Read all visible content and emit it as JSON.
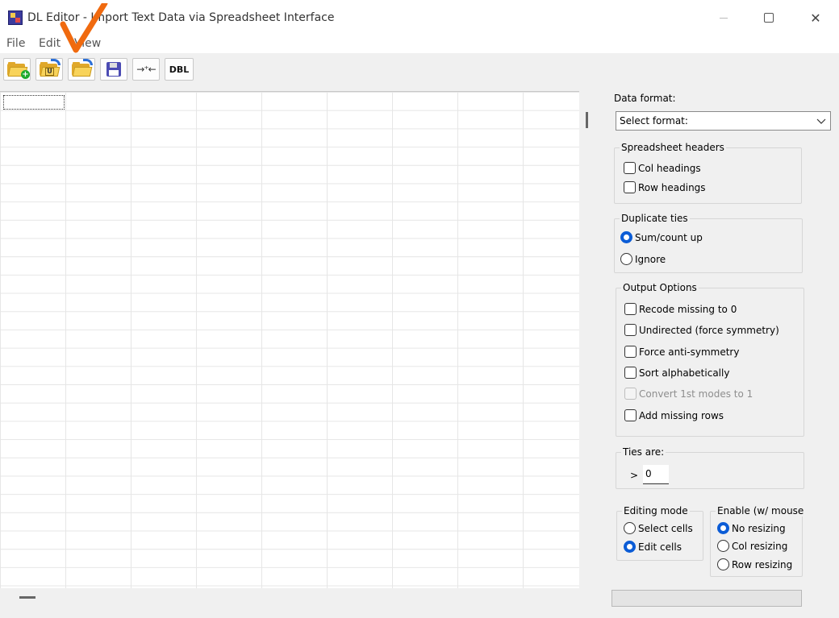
{
  "window": {
    "title": "DL Editor - Import Text Data via Spreadsheet Interface"
  },
  "menu": {
    "items": [
      "File",
      "Edit",
      "View"
    ]
  },
  "toolbar": {
    "buttons": [
      {
        "icon": "open-folder-add-icon"
      },
      {
        "icon": "open-ucinet-folder-icon",
        "badge": "U"
      },
      {
        "icon": "reload-folder-icon"
      },
      {
        "icon": "save-floppy-icon"
      },
      {
        "icon": "collapse-arrows-icon",
        "glyph": "→⁺←"
      },
      {
        "icon": "dbl-icon",
        "label": "DBL"
      }
    ]
  },
  "panel": {
    "data_format_label": "Data format:",
    "data_format_value": "Select format:",
    "headers": {
      "title": "Spreadsheet headers",
      "col": "Col headings",
      "row": "Row headings"
    },
    "duplicate": {
      "title": "Duplicate ties",
      "sum": "Sum/count up",
      "ignore": "Ignore",
      "selected": "Sum/count up"
    },
    "output": {
      "title": "Output Options",
      "recode": "Recode missing to 0",
      "undirected": "Undirected (force symmetry)",
      "antisym": "Force anti-symmetry",
      "sort": "Sort alphabetically",
      "convert": "Convert 1st modes to 1",
      "addrows": "Add missing rows"
    },
    "ties": {
      "title": "Ties are:",
      "operator": ">",
      "value": "0"
    },
    "editing": {
      "title": "Editing mode",
      "select": "Select cells",
      "edit": "Edit cells",
      "selected": "Edit cells"
    },
    "enable": {
      "title": "Enable (w/ mouse",
      "none": "No resizing",
      "col": "Col resizing",
      "row": "Row resizing",
      "selected": "No resizing"
    }
  },
  "colors": {
    "accent": "#0b5cd6",
    "annotation": "#f06a0f",
    "folder": "#f8d35a"
  }
}
